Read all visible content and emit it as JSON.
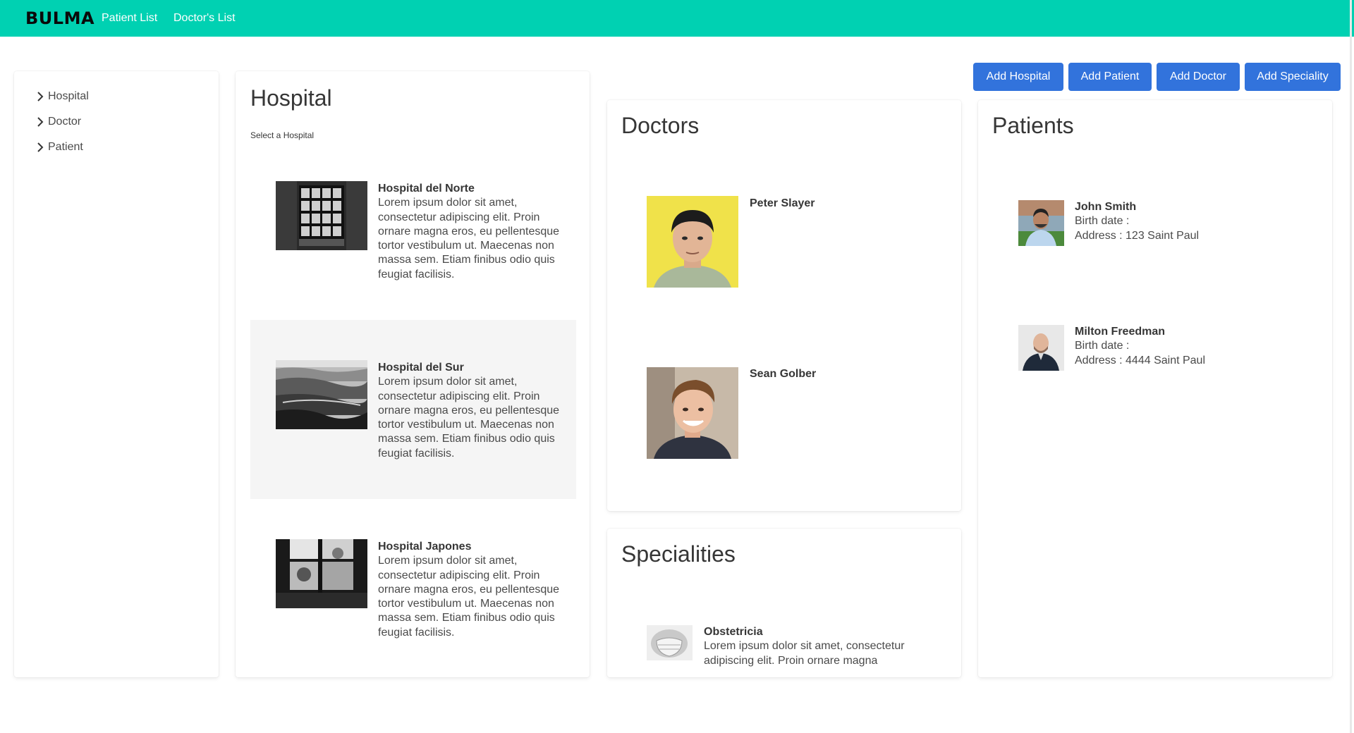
{
  "navbar": {
    "brand": "BULMA",
    "links": [
      "Patient List",
      "Doctor's List"
    ],
    "color": "#00d1b2"
  },
  "sidebar": {
    "items": [
      {
        "label": "Hospital",
        "icon": "chevron-right-icon"
      },
      {
        "label": "Doctor",
        "icon": "chevron-right-icon"
      },
      {
        "label": "Patient",
        "icon": "chevron-right-icon"
      }
    ]
  },
  "toolbar": {
    "buttons": [
      "Add Hospital",
      "Add Patient",
      "Add Doctor",
      "Add Speciality"
    ],
    "button_color": "#3273dc"
  },
  "hospital": {
    "title": "Hospital",
    "subtitle": "Select a Hospital",
    "selected_index": 1,
    "items": [
      {
        "name": "Hospital del Norte",
        "description": "Lorem ipsum dolor sit amet, consectetur adipiscing elit. Proin ornare magna eros, eu pellentesque tortor vestibulum ut. Maecenas non massa sem. Etiam finibus odio quis feugiat facilisis."
      },
      {
        "name": "Hospital del Sur",
        "description": "Lorem ipsum dolor sit amet, consectetur adipiscing elit. Proin ornare magna eros, eu pellentesque tortor vestibulum ut. Maecenas non massa sem. Etiam finibus odio quis feugiat facilisis."
      },
      {
        "name": "Hospital Japones",
        "description": "Lorem ipsum dolor sit amet, consectetur adipiscing elit. Proin ornare magna eros, eu pellentesque tortor vestibulum ut. Maecenas non massa sem. Etiam finibus odio quis feugiat facilisis."
      }
    ]
  },
  "doctors": {
    "title": "Doctors",
    "items": [
      {
        "name": "Peter Slayer"
      },
      {
        "name": "Sean Golber"
      }
    ]
  },
  "specialities": {
    "title": "Specialities",
    "items": [
      {
        "name": "Obstetricia",
        "description": "Lorem ipsum dolor sit amet, consectetur adipiscing elit. Proin ornare magna"
      }
    ]
  },
  "patients": {
    "title": "Patients",
    "items": [
      {
        "name": "John Smith",
        "birth": "Birth date :",
        "address": "Address : 123 Saint Paul"
      },
      {
        "name": "Milton Freedman",
        "birth": "Birth date :",
        "address": "Address : 4444 Saint Paul"
      }
    ]
  }
}
